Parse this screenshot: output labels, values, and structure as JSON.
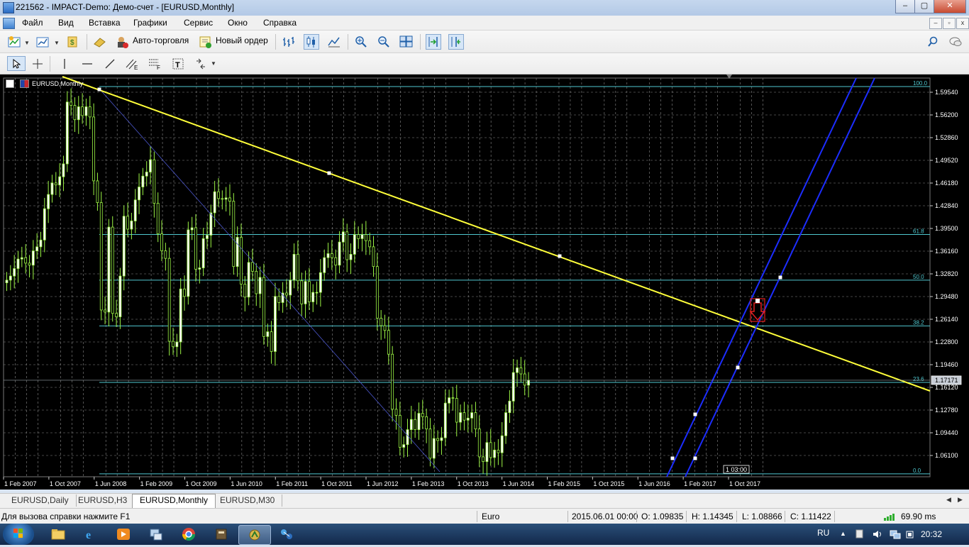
{
  "window": {
    "title": "221562 - IMPACT-Demo: Демо-счет - [EURUSD,Monthly]",
    "controls": [
      "–",
      "▢",
      "✕"
    ]
  },
  "menu": {
    "items": [
      "Файл",
      "Вид",
      "Вставка",
      "Графики",
      "Сервис",
      "Окно",
      "Справка"
    ]
  },
  "toolbar": {
    "auto_trading": "Авто-торговля",
    "new_order": "Новый ордер"
  },
  "toolbar2": {
    "text_tool": "T",
    "fib_tool_e": "E",
    "fib_tool_f": "F"
  },
  "chart": {
    "header": "EURUSD,Monthly",
    "current_price": "1.17171",
    "price_labels": [
      "1.59540",
      "1.56200",
      "1.52860",
      "1.49520",
      "1.46180",
      "1.42840",
      "1.39500",
      "1.36160",
      "1.32820",
      "1.29480",
      "1.26140",
      "1.22800",
      "1.19460",
      "1.16120",
      "1.12780",
      "1.09440",
      "1.06100"
    ],
    "date_labels": [
      "1 Feb 2007",
      "1 Oct 2007",
      "1 Jun 2008",
      "1 Feb 2009",
      "1 Oct 2009",
      "1 Jun 2010",
      "1 Feb 2011",
      "1 Oct 2011",
      "1 Jun 2012",
      "1 Feb 2013",
      "1 Oct 2013",
      "1 Jun 2014",
      "1 Feb 2015",
      "1 Oct 2015",
      "1 Jun 2016",
      "1 Feb 2017",
      "1 Oct 2017"
    ],
    "fib_levels": [
      "100.0",
      "61.8",
      "50.0",
      "38.2",
      "23.6",
      "0.0"
    ],
    "crosshair_time": "1 03:00",
    "colors": {
      "background": "#000000",
      "grid": "#8a8a8a",
      "bull_candle": "#ffffff",
      "bear_candle": "#000000",
      "wick": "#9cf545",
      "trendline": "#ffff3a",
      "channel": "#1c2dff",
      "fibo": "#4fc7cf",
      "down_arrow": "#e21f1f"
    }
  },
  "tabs": [
    "EURUSD,Daily",
    "EURUSD,H3",
    "EURUSD,Monthly",
    "EURUSD,M30"
  ],
  "active_tab": "EURUSD,Monthly",
  "status": {
    "help": "Для вызова справки нажмите F1",
    "profile": "Euro",
    "datetime": "2015.06.01 00:00",
    "open": "O: 1.09835",
    "high": "H: 1.14345",
    "low": "L: 1.08866",
    "close": "C: 1.11422",
    "ping": "69.90 ms"
  },
  "taskbar": {
    "lang": "RU",
    "clock": "20:32"
  }
}
